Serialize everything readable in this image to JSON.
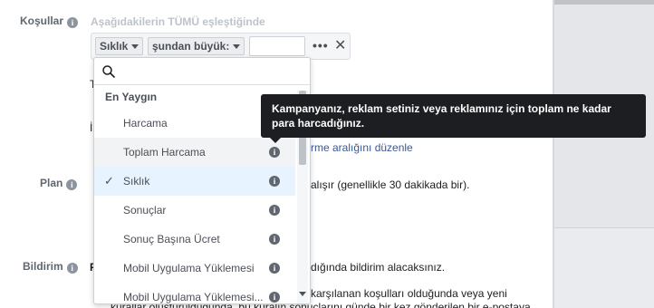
{
  "labels": {
    "conditions": "Koşullar",
    "plan": "Plan",
    "notification": "Bildirim"
  },
  "conditions_hint": "Aşağıdakilerin TÜMÜ eşleştiğinde",
  "filter": {
    "metric_chip": "Sıklık",
    "operator_chip": "şundan büyük:",
    "value": "",
    "more_label": "•••",
    "close_label": "✕"
  },
  "background": {
    "t_fragment": "T",
    "i_fragment": "İ",
    "edit_range_link": "rme aralığını düzenle",
    "plan_text": "alışır (genellikle 30 dakikada bir).",
    "notify_text": "dığında bildirim alacaksınız.",
    "p_fragment": "P",
    "line3a": "karşılanan koşulları olduğunda veya yeni",
    "line3b": "kurallar oluşturulduğunda, bu kuralın sonuçlarını günde bir kez gönderilen bir e-postaya"
  },
  "dropdown": {
    "search_value": "",
    "section_title": "En Yaygın",
    "items": [
      {
        "label": "Harcama"
      },
      {
        "label": "Toplam Harcama"
      },
      {
        "label": "Sıklık",
        "selected": true
      },
      {
        "label": "Sonuçlar"
      },
      {
        "label": "Sonuç Başına Ücret"
      },
      {
        "label": "Mobil Uygulama Yüklemesi"
      },
      {
        "label": "Mobil Uygulama Yüklemesi..."
      }
    ]
  },
  "tooltip": {
    "line1": "Kampanyanız, reklam setiniz veya reklamınız için toplam ne kadar",
    "line2": "para harcadığınız."
  },
  "icons": {
    "info": "info-icon",
    "search": "search-icon",
    "check": "checkmark-icon",
    "close": "close-icon",
    "more": "more-icon"
  },
  "colors": {
    "tooltip_bg": "#1c1e21",
    "selected_bg": "#e7f3ff",
    "link": "#385898"
  }
}
